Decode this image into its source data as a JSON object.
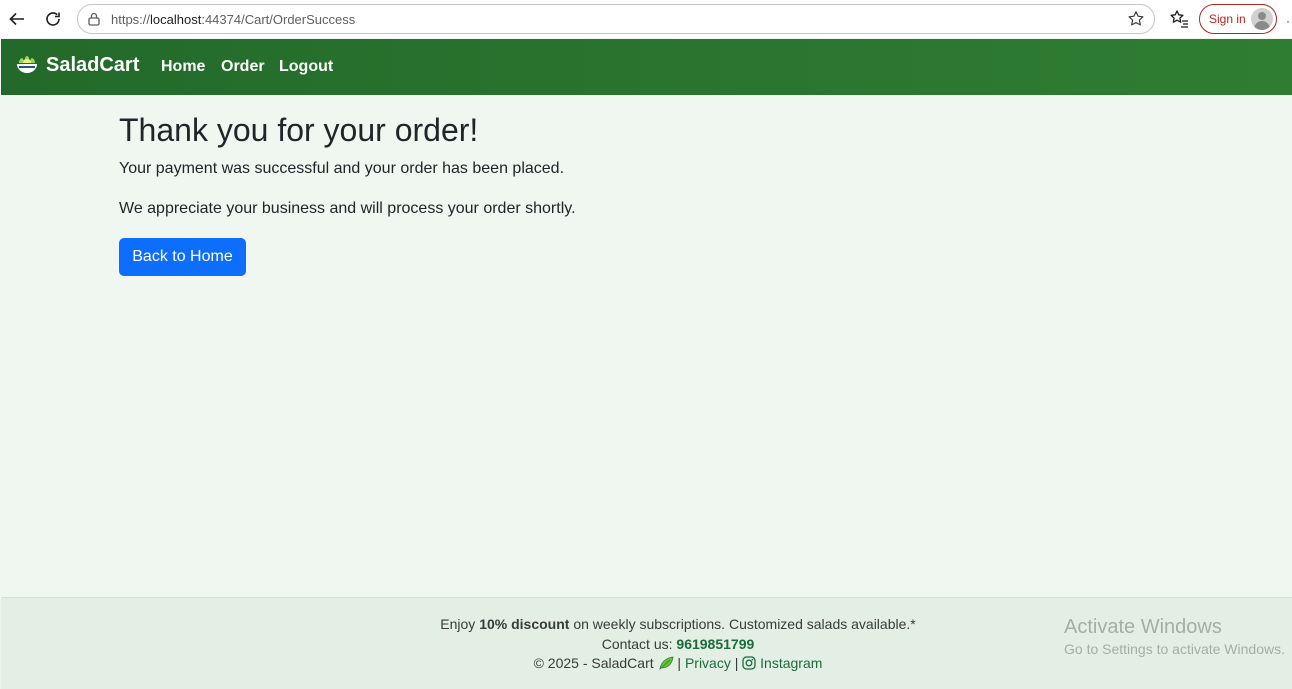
{
  "browser": {
    "url_prefix": "https://",
    "url_host": "localhost",
    "url_path": ":44374/Cart/OrderSuccess",
    "signin_label": "Sign in"
  },
  "nav": {
    "brand": "SaladCart",
    "links": [
      "Home",
      "Order",
      "Logout"
    ],
    "brand_color": "#2a7530"
  },
  "main": {
    "title": "Thank you for your order!",
    "message1": "Your payment was successful and your order has been placed.",
    "message2": "We appreciate your business and will process your order shortly.",
    "button_label": "Back to Home",
    "button_color": "#0d6efd"
  },
  "footer": {
    "promo_prefix": "Enjoy ",
    "promo_bold": "10% discount",
    "promo_suffix": " on weekly subscriptions. Customized salads available.*",
    "contact_label": "Contact us: ",
    "phone": "9619851799",
    "copyright": "© 2025 - SaladCart",
    "separator": "|",
    "privacy": "Privacy",
    "instagram": "Instagram"
  },
  "watermark": {
    "line1": "Activate Windows",
    "line2": "Go to Settings to activate Windows."
  }
}
